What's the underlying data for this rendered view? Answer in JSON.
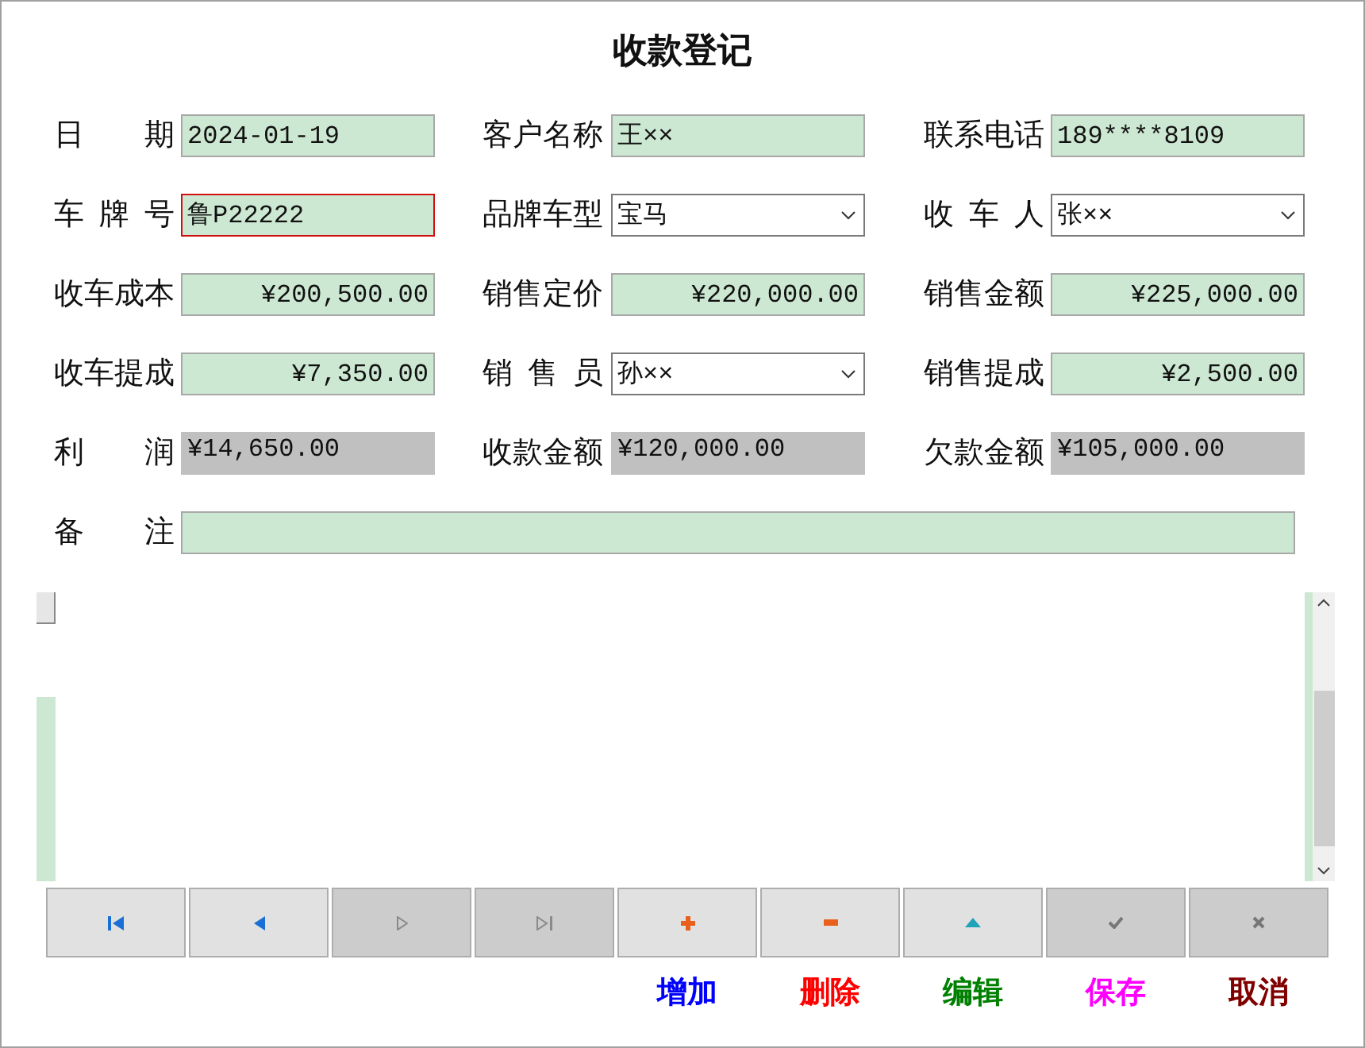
{
  "window": {
    "title": "收款登记"
  },
  "fields": [
    {
      "label": "日 期",
      "value": "2024-01-19",
      "kind": "text",
      "focused": false
    },
    {
      "label": "客户名称",
      "value": "王××",
      "kind": "text",
      "focused": false
    },
    {
      "label": "联系电话",
      "value": "189****8109",
      "kind": "text",
      "focused": false
    },
    {
      "label": "车 牌 号",
      "value": "鲁P22222",
      "kind": "text",
      "focused": true
    },
    {
      "label": "品牌车型",
      "value": "宝马",
      "kind": "select",
      "focused": false
    },
    {
      "label": "收 车 人",
      "value": "张××",
      "kind": "select",
      "focused": false
    },
    {
      "label": "收车成本",
      "value": "¥200,500.00",
      "kind": "amount",
      "focused": false
    },
    {
      "label": "销售定价",
      "value": "¥220,000.00",
      "kind": "amount",
      "focused": false
    },
    {
      "label": "销售金额",
      "value": "¥225,000.00",
      "kind": "amount",
      "focused": false
    },
    {
      "label": "收车提成",
      "value": "¥7,350.00",
      "kind": "amount",
      "focused": false
    },
    {
      "label": "销 售 员",
      "value": "孙××",
      "kind": "select",
      "focused": false
    },
    {
      "label": "销售提成",
      "value": "¥2,500.00",
      "kind": "amount",
      "focused": false
    },
    {
      "label": "利 润",
      "value": "¥14,650.00",
      "kind": "readonly",
      "focused": false
    },
    {
      "label": "收款金额",
      "value": "¥120,000.00",
      "kind": "readonly",
      "focused": false
    },
    {
      "label": "欠款金额",
      "value": "¥105,000.00",
      "kind": "readonly",
      "focused": false
    }
  ],
  "remarks": {
    "label": "备 注"
  },
  "nav_buttons": [
    {
      "kind": "first",
      "disabled": false
    },
    {
      "kind": "prev",
      "disabled": false
    },
    {
      "kind": "next",
      "disabled": true
    },
    {
      "kind": "last",
      "disabled": true
    },
    {
      "kind": "add",
      "disabled": false
    },
    {
      "kind": "delete",
      "disabled": false
    },
    {
      "kind": "edit",
      "disabled": false
    },
    {
      "kind": "save",
      "disabled": true
    },
    {
      "kind": "cancel",
      "disabled": true
    }
  ],
  "action_labels": [
    {
      "text": "增加",
      "color": "#0000ff"
    },
    {
      "text": "删除",
      "color": "#ff0000"
    },
    {
      "text": "编辑",
      "color": "#008000"
    },
    {
      "text": "保存",
      "color": "#ff00ff"
    },
    {
      "text": "取消",
      "color": "#800000"
    }
  ]
}
